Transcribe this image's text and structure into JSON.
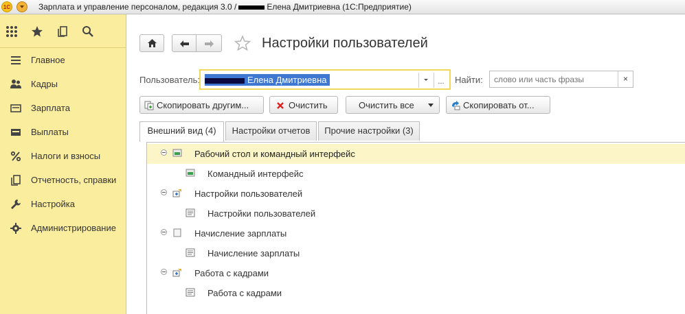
{
  "window": {
    "title_prefix": "Зарплата и управление персоналом, редакция 3.0 /",
    "title_suffix": "Елена Дмитриевна  (1С:Предприятие)",
    "logo_text": "1С"
  },
  "sidebar": {
    "items": [
      {
        "label": "Главное",
        "icon": "menu-lines-icon"
      },
      {
        "label": "Кадры",
        "icon": "people-icon"
      },
      {
        "label": "Зарплата",
        "icon": "payslip-icon"
      },
      {
        "label": "Выплаты",
        "icon": "wallet-icon"
      },
      {
        "label": "Налоги и взносы",
        "icon": "percent-icon"
      },
      {
        "label": "Отчетность, справки",
        "icon": "reports-icon"
      },
      {
        "label": "Настройка",
        "icon": "wrench-icon"
      },
      {
        "label": "Администрирование",
        "icon": "gear-icon"
      }
    ]
  },
  "page": {
    "title": "Настройки пользователей",
    "user_label": "Пользователь:",
    "user_value": "Елена Дмитриевна",
    "find_label": "Найти:",
    "search_placeholder": "слово или часть фразы",
    "clear_symbol": "×",
    "dots": "..."
  },
  "toolbar": {
    "copy_to_others": "Скопировать другим...",
    "clear": "Очистить",
    "clear_all": "Очистить все",
    "copy_from": "Скопировать от..."
  },
  "tabs": [
    {
      "label": "Внешний вид (4)",
      "active": true
    },
    {
      "label": "Настройки отчетов",
      "active": false
    },
    {
      "label": "Прочие настройки (3)",
      "active": false
    }
  ],
  "tree": [
    {
      "label": "Рабочий стол и командный интерфейс",
      "level": 0,
      "selected": true
    },
    {
      "label": "Командный интерфейс",
      "level": 1
    },
    {
      "label": "Настройки пользователей",
      "level": 0
    },
    {
      "label": "Настройки пользователей",
      "level": 1
    },
    {
      "label": "Начисление зарплаты",
      "level": 0
    },
    {
      "label": "Начисление зарплаты",
      "level": 1
    },
    {
      "label": "Работа с кадрами",
      "level": 0
    },
    {
      "label": "Работа с кадрами",
      "level": 1
    }
  ],
  "colors": {
    "sidebar_bg": "#fbed9e",
    "selection_bg": "#3e78d3",
    "highlight_row": "#fbf5c8",
    "focus_border": "#f0d85a"
  }
}
